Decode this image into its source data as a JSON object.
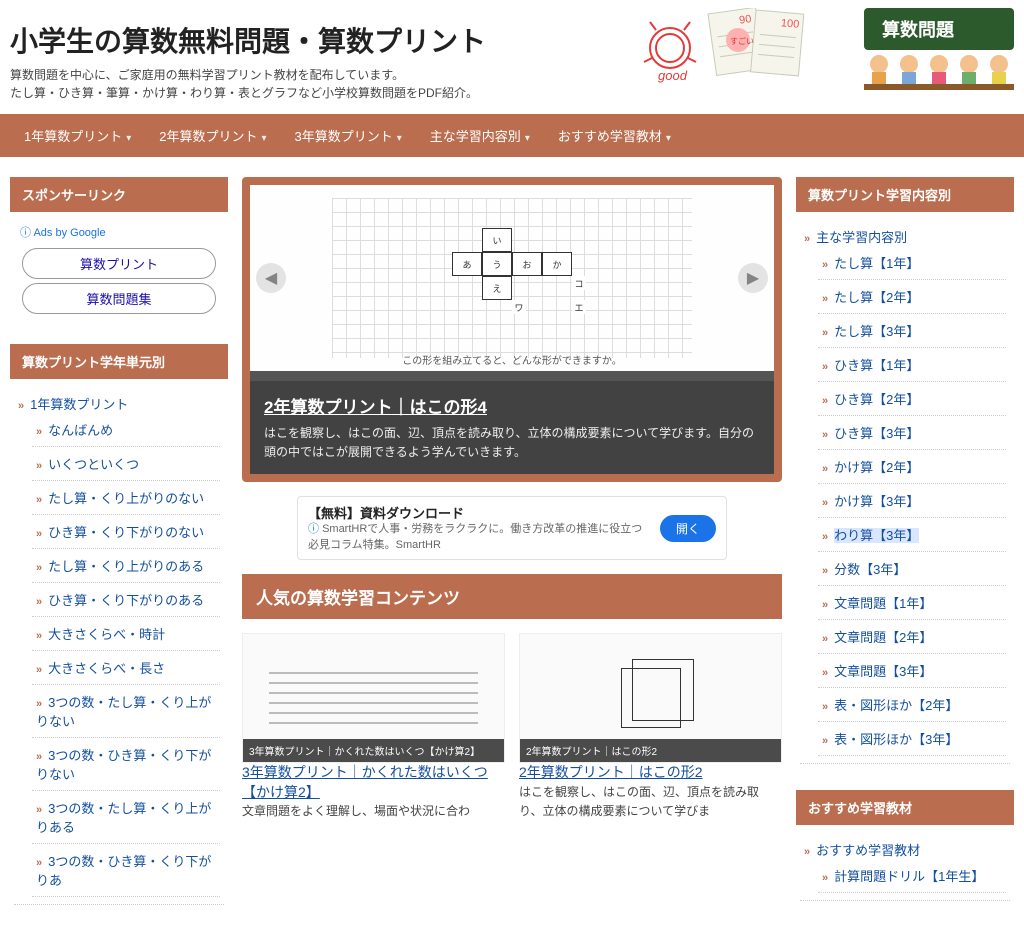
{
  "header": {
    "title": "小学生の算数無料問題・算数プリント",
    "desc1": "算数問題を中心に、ご家庭用の無料学習プリント教材を配布しています。",
    "desc2": "たし算・ひき算・筆算・かけ算・わり算・表とグラフなど小学校算数問題をPDF紹介。",
    "badge": "算数問題"
  },
  "nav": [
    "1年算数プリント",
    "2年算数プリント",
    "3年算数プリント",
    "主な学習内容別",
    "おすすめ学習教材"
  ],
  "left": {
    "sponsor_title": "スポンサーリンク",
    "ads_label": "Ads by Google",
    "pill1": "算数プリント",
    "pill2": "算数問題集",
    "units_title": "算数プリント学年単元別",
    "units_head": "1年算数プリント",
    "units": [
      "なんばんめ",
      "いくつといくつ",
      "たし算・くり上がりのない",
      "ひき算・くり下がりのない",
      "たし算・くり上がりのある",
      "ひき算・くり下がりのある",
      "大きさくらべ・時計",
      "大きさくらべ・長さ",
      "3つの数・たし算・くり上がりない",
      "3つの数・ひき算・くり下がりない",
      "3つの数・たし算・くり上がりある",
      "3つの数・ひき算・くり下がりあ"
    ]
  },
  "slider": {
    "caption_sub": "この形を組み立てると、どんな形ができますか。",
    "title": "2年算数プリント｜はこの形4",
    "desc": "はこを観察し、はこの面、辺、頂点を読み取り、立体の構成要素について学びます。自分の頭の中ではこが展開できるよう学んでいきます。",
    "net": {
      "a": "あ",
      "i": "い",
      "u": "う",
      "e": "え",
      "o": "お",
      "ka": "か",
      "wa": "ワ",
      "ko": "コ",
      "e2": "エ"
    }
  },
  "ad": {
    "title": "【無料】資料ダウンロード",
    "sub": "SmartHRで人事・労務をラクラクに。働き方改革の推進に役立つ必見コラム特集。SmartHR",
    "btn": "開く"
  },
  "popular": {
    "title": "人気の算数学習コンテンツ",
    "cards": [
      {
        "label": "3年算数プリント｜かくれた数はいくつ【かけ算2】",
        "title": "3年算数プリント｜かくれた数はいくつ【かけ算2】",
        "desc": "文章問題をよく理解し、場面や状況に合わ"
      },
      {
        "label": "2年算数プリント｜はこの形2",
        "title": "2年算数プリント｜はこの形2",
        "desc": "はこを観察し、はこの面、辺、頂点を読み取り、立体の構成要素について学びま"
      }
    ]
  },
  "right": {
    "cat_title": "算数プリント学習内容別",
    "cat_head": "主な学習内容別",
    "cats": [
      "たし算【1年】",
      "たし算【2年】",
      "たし算【3年】",
      "ひき算【1年】",
      "ひき算【2年】",
      "ひき算【3年】",
      "かけ算【2年】",
      "かけ算【3年】",
      "わり算【3年】",
      "分数【3年】",
      "文章問題【1年】",
      "文章問題【2年】",
      "文章問題【3年】",
      "表・図形ほか【2年】",
      "表・図形ほか【3年】"
    ],
    "cat_hl_index": 8,
    "rec_title": "おすすめ学習教材",
    "rec_head": "おすすめ学習教材",
    "recs": [
      "計算問題ドリル【1年生】"
    ]
  }
}
